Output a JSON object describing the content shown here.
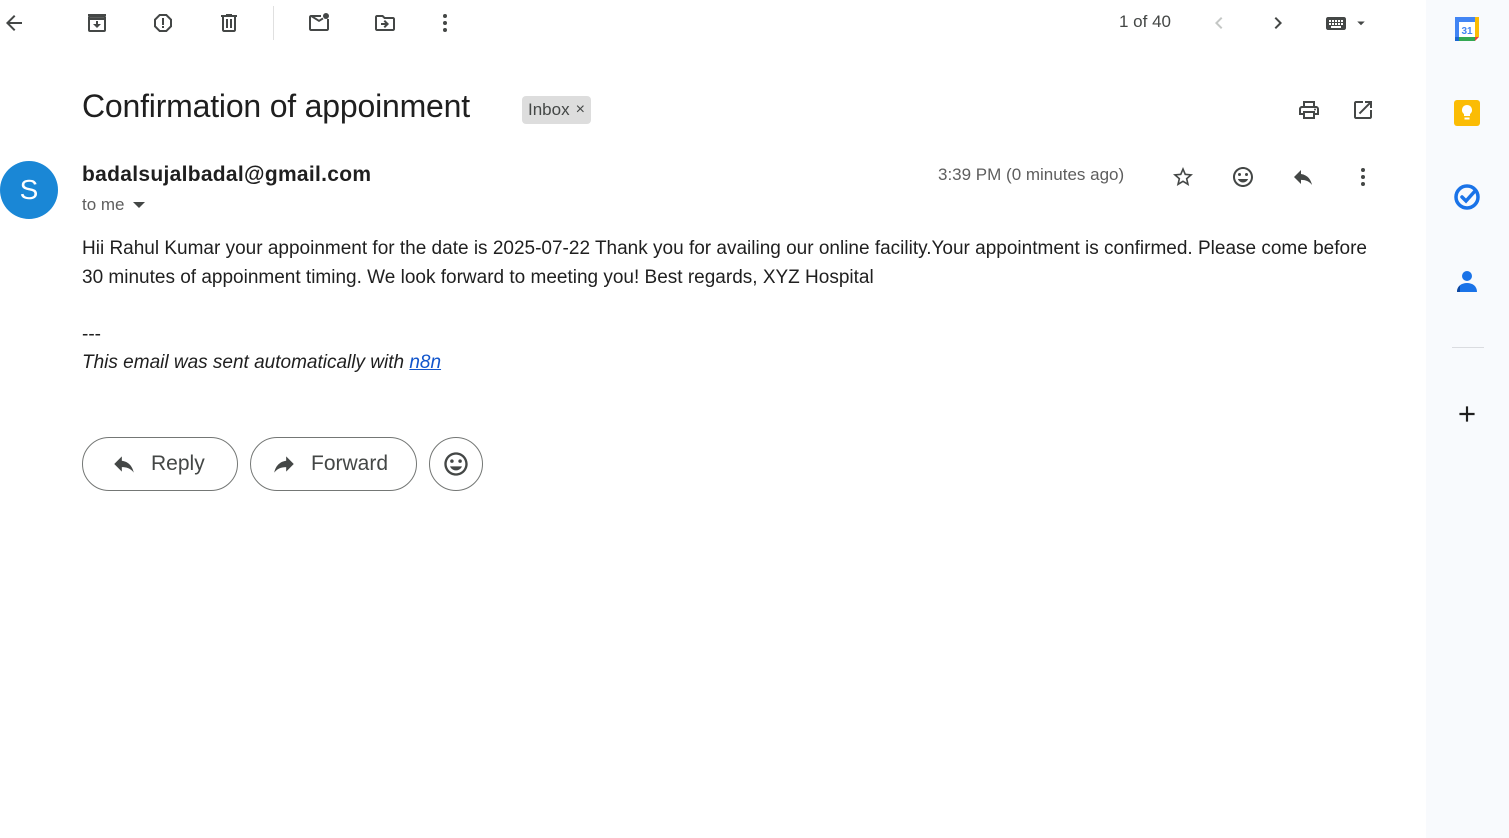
{
  "toolbar": {
    "back_icon": "arrow-left-icon",
    "archive_icon": "archive-icon",
    "spam_icon": "report-spam-icon",
    "delete_icon": "trash-icon",
    "unread_icon": "mark-unread-icon",
    "move_icon": "move-to-icon",
    "more_icon": "more-vert-icon",
    "pager": "1 of 40",
    "input_tools_icon": "keyboard-icon"
  },
  "message": {
    "subject": "Confirmation of appoinment",
    "label": "Inbox",
    "label_remove": "×",
    "avatar_letter": "S",
    "avatar_color": "#1a87d6",
    "sender": "badalsujalbadal@gmail.com",
    "recipient": "to me",
    "timestamp": "3:39 PM (0 minutes ago)",
    "body": "Hii Rahul Kumar your appoinment for the date is 2025-07-22 Thank you for availing our online facility.Your appointment is confirmed. Please come before 30 minutes of appoinment timing. We look forward to meeting you! Best regards, XYZ Hospital",
    "signature_separator": "---",
    "signature_text": "This email was sent automatically with ",
    "signature_link": "n8n",
    "link_color": "#1155cc"
  },
  "actions": {
    "reply_label": "Reply",
    "forward_label": "Forward"
  },
  "side_panel": {
    "calendar_day": "31",
    "apps": [
      "calendar-icon",
      "keep-icon",
      "tasks-icon",
      "contacts-icon",
      "add-icon"
    ]
  }
}
